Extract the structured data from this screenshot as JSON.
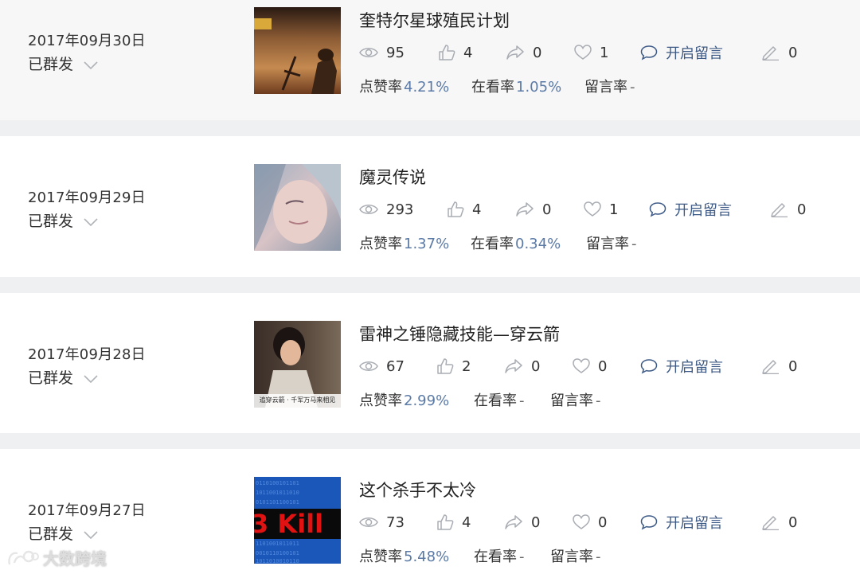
{
  "posts": [
    {
      "date": "2017年09月30日",
      "status": "已群发",
      "title": "奎特尔星球殖民计划",
      "views": "95",
      "likes": "4",
      "shares": "0",
      "favorites": "1",
      "reply_label": "开启留言",
      "edits": "0",
      "like_rate_label": "点赞率",
      "like_rate": "4.21%",
      "watch_rate_label": "在看率",
      "watch_rate": "1.05%",
      "comment_rate_label": "留言率",
      "comment_rate": "-"
    },
    {
      "date": "2017年09月29日",
      "status": "已群发",
      "title": "魔灵传说",
      "views": "293",
      "likes": "4",
      "shares": "0",
      "favorites": "1",
      "reply_label": "开启留言",
      "edits": "0",
      "like_rate_label": "点赞率",
      "like_rate": "1.37%",
      "watch_rate_label": "在看率",
      "watch_rate": "0.34%",
      "comment_rate_label": "留言率",
      "comment_rate": "-"
    },
    {
      "date": "2017年09月28日",
      "status": "已群发",
      "title": "雷神之锤隐藏技能—穿云箭",
      "thumb_caption": "追穿云箭 · 千军万马来相见",
      "views": "67",
      "likes": "2",
      "shares": "0",
      "favorites": "0",
      "reply_label": "开启留言",
      "edits": "0",
      "like_rate_label": "点赞率",
      "like_rate": "2.99%",
      "watch_rate_label": "在看率",
      "watch_rate": "-",
      "comment_rate_label": "留言率",
      "comment_rate": "-"
    },
    {
      "date": "2017年09月27日",
      "status": "已群发",
      "title": "这个杀手不太冷",
      "thumb_caption": "3 Kill",
      "views": "73",
      "likes": "4",
      "shares": "0",
      "favorites": "0",
      "reply_label": "开启留言",
      "edits": "0",
      "like_rate_label": "点赞率",
      "like_rate": "5.48%",
      "watch_rate_label": "在看率",
      "watch_rate": "-",
      "comment_rate_label": "留言率",
      "comment_rate": "-"
    }
  ],
  "watermark": {
    "text": "大数跨境"
  },
  "colors": {
    "separator": "#eef0f2",
    "link": "#3d5a86",
    "rate_value": "#5b7aa6",
    "icon": "#a9adb3"
  }
}
